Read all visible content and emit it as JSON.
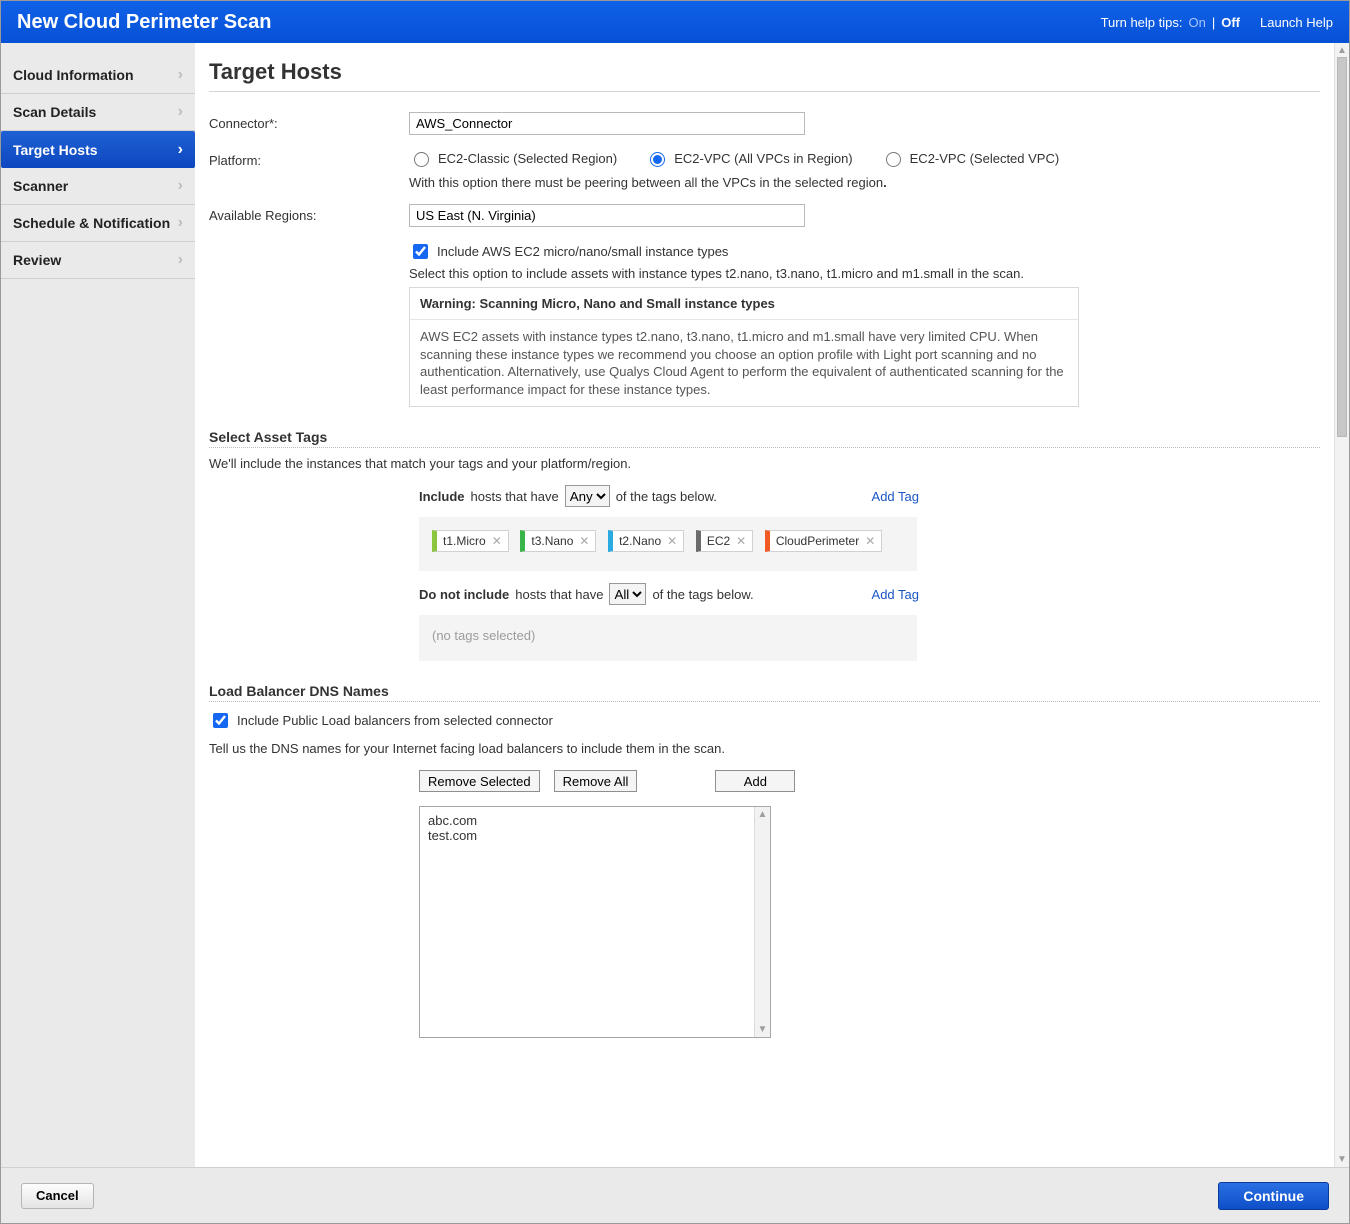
{
  "header": {
    "title": "New Cloud Perimeter Scan",
    "help_tips_label": "Turn help tips:",
    "help_on": "On",
    "help_sep": "|",
    "help_off": "Off",
    "launch_help": "Launch Help"
  },
  "sidebar": {
    "items": [
      {
        "label": "Cloud Information"
      },
      {
        "label": "Scan Details"
      },
      {
        "label": "Target Hosts",
        "active": true
      },
      {
        "label": "Scanner"
      },
      {
        "label": "Schedule & Notification"
      },
      {
        "label": "Review"
      }
    ]
  },
  "page": {
    "title": "Target Hosts",
    "connector_label": "Connector*:",
    "connector_value": "AWS_Connector",
    "platform_label": "Platform:",
    "platform_options": {
      "classic": "EC2-Classic (Selected Region)",
      "vpc_all": "EC2-VPC (All VPCs in Region)",
      "vpc_sel": "EC2-VPC (Selected VPC)"
    },
    "platform_note": "With this option there must be peering between all the VPCs in the selected region",
    "regions_label": "Available Regions:",
    "regions_value": "US East (N. Virginia)",
    "include_small_label": "Include AWS EC2 micro/nano/small instance types",
    "include_small_note": "Select this option to include assets with instance types t2.nano, t3.nano, t1.micro and m1.small in the scan.",
    "warn_title": "Warning: Scanning Micro, Nano and Small instance types",
    "warn_body": "AWS EC2 assets with instance types t2.nano, t3.nano, t1.micro and m1.small have very limited CPU. When scanning these instance types we recommend you choose an option profile with Light port scanning and no authentication. Alternatively, use Qualys Cloud Agent to perform the equivalent of authenticated scanning for the least performance impact for these instance types.",
    "tags_header": "Select Asset Tags",
    "tags_hint": "We'll include the instances that match your tags and your platform/region.",
    "include_prefix": "Include",
    "include_mid": "hosts that have",
    "include_suffix": "of the tags below.",
    "include_mode": "Any",
    "add_tag": "Add Tag",
    "include_tags": [
      "t1.Micro",
      "t3.Nano",
      "t2.Nano",
      "EC2",
      "CloudPerimeter"
    ],
    "exclude_prefix": "Do not include",
    "exclude_mid": "hosts that have",
    "exclude_suffix": "of the tags below.",
    "exclude_mode": "All",
    "no_tags": "(no tags selected)",
    "lb_header": "Load Balancer DNS Names",
    "lb_checkbox": "Include Public Load balancers from selected connector",
    "lb_hint": "Tell us the DNS names for your Internet facing load balancers to include them in the scan.",
    "btn_remove_selected": "Remove Selected",
    "btn_remove_all": "Remove All",
    "btn_add": "Add",
    "dns_list": [
      "abc.com",
      "test.com"
    ]
  },
  "footer": {
    "cancel": "Cancel",
    "continue": "Continue"
  }
}
